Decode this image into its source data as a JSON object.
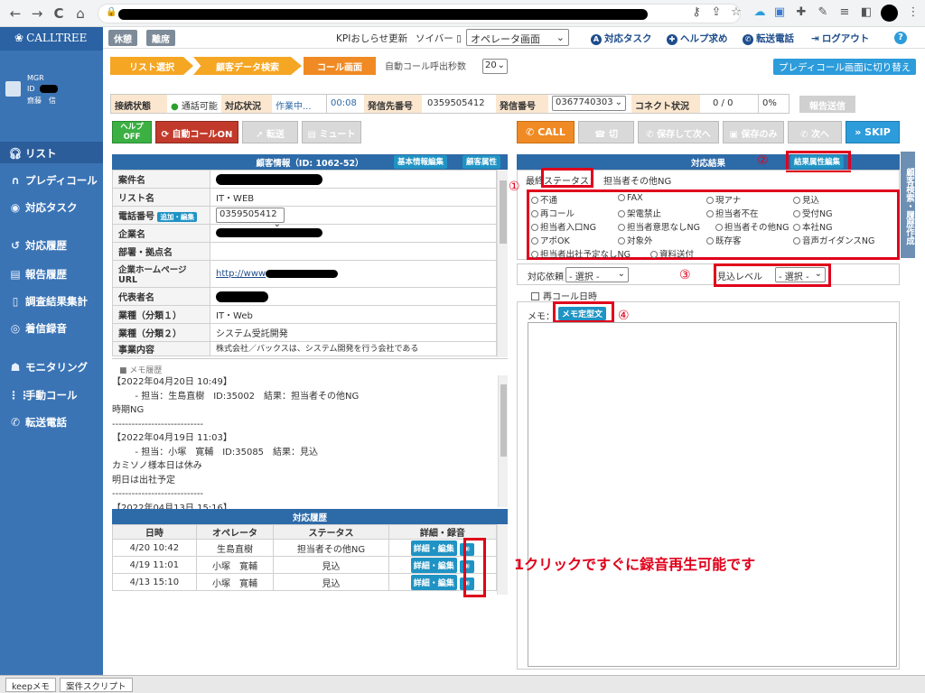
{
  "browser": {
    "back": "←",
    "forward": "→",
    "reload": "C",
    "home": "⌂"
  },
  "app": {
    "logo": "CALLTREE"
  },
  "user": {
    "role": "MGR",
    "id_label": "ID",
    "name": "齋藤　信"
  },
  "sidebar": {
    "items": [
      {
        "label": "リスト",
        "icon": "headset-icon"
      },
      {
        "label": "プレディコール",
        "icon": "headset-icon"
      },
      {
        "label": "対応タスク",
        "icon": "task-icon"
      },
      {
        "label": "対応履歴",
        "icon": "history-icon"
      },
      {
        "label": "報告履歴",
        "icon": "report-icon"
      },
      {
        "label": "調査結果集計",
        "icon": "survey-icon"
      },
      {
        "label": "着信録音",
        "icon": "record-icon"
      },
      {
        "label": "モニタリング",
        "icon": "monitor-icon"
      },
      {
        "label": "手動コール",
        "icon": "dialpad-icon"
      },
      {
        "label": "転送電話",
        "icon": "phone-icon"
      }
    ]
  },
  "topbar": {
    "rest": "休憩",
    "leave": "離席",
    "kpi": "KPIおしらせ更新",
    "soiba": "ソイバー ▯",
    "screen_select": "オペレータ画面",
    "task": "対応タスク",
    "help": "ヘルプ求め",
    "transfer": "転送電話",
    "logout": "ログアウト",
    "question": "?"
  },
  "steps": {
    "s1": "リスト選択",
    "s2": "顧客データ検索",
    "s3": "コール画面",
    "auto_label": "自動コール呼出秒数",
    "auto_value": "20",
    "switch": "プレディコール画面に切り替え"
  },
  "status": {
    "conn_label": "接続状態",
    "conn_value": "通話可能",
    "resp_label": "対応状況",
    "resp_value": "作業中...",
    "timer": "00:08",
    "dest_label": "発信先番号",
    "dest_value": "0359505412",
    "src_label": "発信番号",
    "src_value": "0367740303",
    "connect_label": "コネクト状況",
    "connect_value": "0 / 0",
    "connect_pct": "0%",
    "report": "報告送信"
  },
  "controls": {
    "help": "ヘルプ\nOFF",
    "auto": "自動コールON",
    "forward": "転送",
    "mute": "ミュート",
    "call": "CALL",
    "hangup": "切",
    "save_next": "保存して次へ",
    "save_only": "保存のみ",
    "next": "次へ",
    "skip": "SKIP"
  },
  "customer": {
    "header": "顧客情報（ID: 1062-52）",
    "basic_edit": "基本情報編集",
    "attr": "顧客属性",
    "rows": [
      {
        "k": "案件名",
        "v": ""
      },
      {
        "k": "リスト名",
        "v": "IT・WEB"
      },
      {
        "k": "電話番号",
        "v": "0359505412",
        "add": "追加・編集"
      },
      {
        "k": "企業名",
        "v": ""
      },
      {
        "k": "部署・拠点名",
        "v": ""
      },
      {
        "k": "企業ホームページURL",
        "v": "http://www"
      },
      {
        "k": "代表者名",
        "v": ""
      },
      {
        "k": "業種（分類１）",
        "v": "IT・Web"
      },
      {
        "k": "業種（分類２）",
        "v": "システム受託開発"
      },
      {
        "k": "事業内容",
        "v": "株式会社／バックスは、システム開発を行う会社である"
      }
    ]
  },
  "memo_history": {
    "title": "■ メモ履歴",
    "text": "【2022年04月20日 10:49】\n        - 担当：生島直樹　ID:35002　結果：担当者その他NG\n時期NG\n----------------------------\n【2022年04月19日 11:03】\n        - 担当：小塚　寛輔　ID:35085　結果：見込\nカミソノ様本日は休み\n明日は出社予定\n----------------------------\n【2022年04月13日 15:16】"
  },
  "history": {
    "title": "対応履歴",
    "cols": [
      "日時",
      "オペレータ",
      "ステータス",
      "詳細・録音"
    ],
    "detail_btn": "詳細・編集",
    "rows": [
      {
        "date": "4/20 10:42",
        "op": "生島直樹",
        "status": "担当者その他NG"
      },
      {
        "date": "4/19 11:01",
        "op": "小塚　寛輔",
        "status": "見込"
      },
      {
        "date": "4/13 15:10",
        "op": "小塚　寛輔",
        "status": "見込"
      }
    ]
  },
  "result": {
    "header": "対応結果",
    "attr_edit": "結果属性編集",
    "final_label": "最終ステータス：",
    "final_value": "担当者その他NG",
    "options": [
      "不通",
      "FAX",
      "現アナ",
      "見込",
      "再コール",
      "架電禁止",
      "担当者不在",
      "受付NG",
      "担当者入口NG",
      "担当者意思なしNG",
      "担当者その他NG",
      "本社NG",
      "アポOK",
      "対象外",
      "既存客",
      "音声ガイダンスNG",
      "担当者出社予定なしNG",
      "資料送付"
    ],
    "request_label": "対応依頼",
    "request_value": "- 選択 -",
    "level_label": "見込レベル",
    "level_value": "- 選択 -",
    "recall": "再コール日時",
    "memo_label": "メモ：",
    "memo_tpl": "メモ定型文"
  },
  "annotations": {
    "n1": "①",
    "n2": "②",
    "n3": "③",
    "n4": "④",
    "note": "1クリックですぐに録音再生可能です"
  },
  "vertical_tab": "顧客検索・履歴作成",
  "bottom": {
    "tab1": "keepメモ",
    "tab2": "案件スクリプト"
  }
}
